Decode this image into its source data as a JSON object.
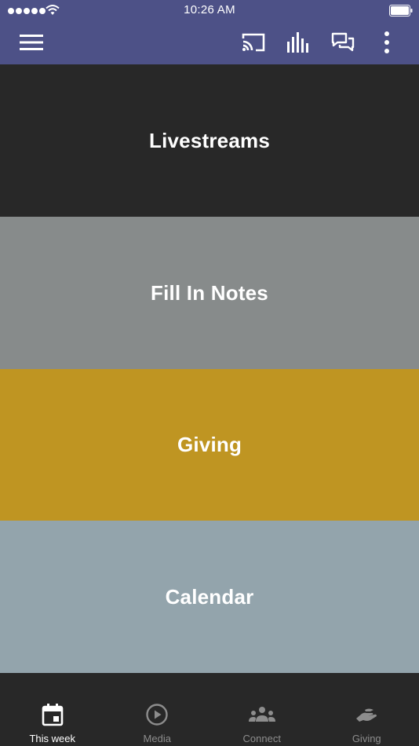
{
  "status_bar": {
    "time": "10:26 AM"
  },
  "app_bar": {
    "background": "#4d5187",
    "icons": [
      "menu-icon",
      "cast-icon",
      "equalizer-icon",
      "chat-icon",
      "more-vert-icon"
    ]
  },
  "tiles": [
    {
      "label": "Livestreams",
      "color": "#282828"
    },
    {
      "label": "Fill In Notes",
      "color": "#878b8b"
    },
    {
      "label": "Giving",
      "color": "#bf9522"
    },
    {
      "label": "Calendar",
      "color": "#93a4ac"
    }
  ],
  "bottom_nav": {
    "items": [
      {
        "label": "This week",
        "icon": "calendar-icon",
        "active": true
      },
      {
        "label": "Media",
        "icon": "play-circle-icon",
        "active": false
      },
      {
        "label": "Connect",
        "icon": "people-icon",
        "active": false
      },
      {
        "label": "Giving",
        "icon": "giving-hand-icon",
        "active": false
      }
    ]
  }
}
